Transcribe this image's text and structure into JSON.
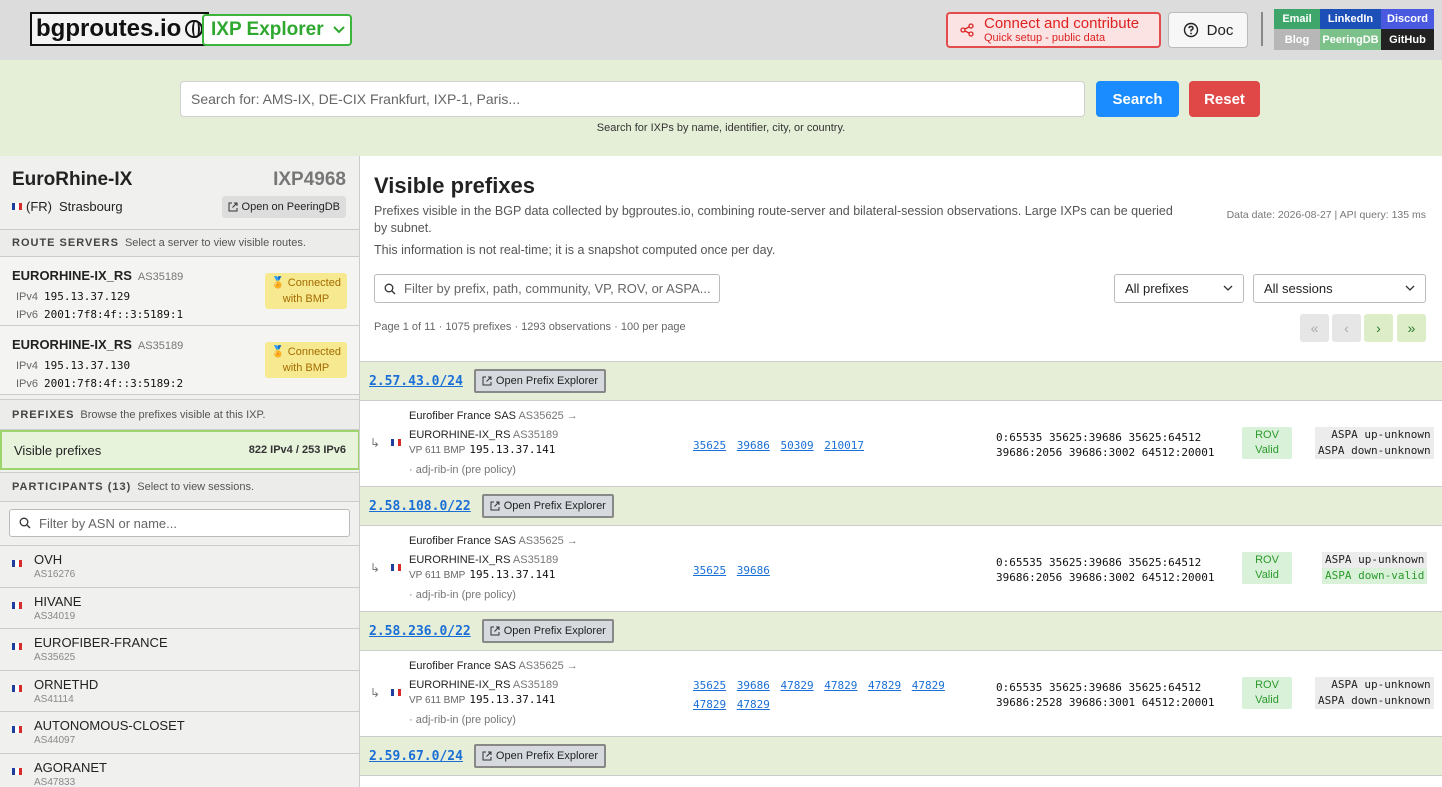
{
  "header": {
    "logo": "bgproutes.io",
    "selector": "IXP Explorer",
    "connect_title": "Connect and contribute",
    "connect_sub": "Quick setup - public data",
    "doc": "Doc",
    "links": {
      "email": "Email",
      "linkedin": "LinkedIn",
      "discord": "Discord",
      "blog": "Blog",
      "peeringdb": "PeeringDB",
      "github": "GitHub"
    }
  },
  "search": {
    "placeholder": "Search for: AMS-IX, DE-CIX Frankfurt, IXP-1, Paris...",
    "search_label": "Search",
    "reset_label": "Reset",
    "hint": "Search for IXPs by name, identifier, city, or country."
  },
  "ixp": {
    "name": "EuroRhine-IX",
    "id": "IXP4968",
    "country": "(FR)",
    "city": "Strasbourg",
    "peeringdb": "Open on PeeringDB"
  },
  "route_servers": {
    "title": "ROUTE SERVERS",
    "hint": "Select a server to view visible routes.",
    "items": [
      {
        "name": "EURORHINE-IX_RS",
        "asn": "AS35189",
        "ipv4_label": "IPv4",
        "ipv4": "195.13.37.129",
        "ipv6_label": "IPv6",
        "ipv6": "2001:7f8:4f::3:5189:1",
        "status_line1": "Connected",
        "status_line2": "with BMP"
      },
      {
        "name": "EURORHINE-IX_RS",
        "asn": "AS35189",
        "ipv4_label": "IPv4",
        "ipv4": "195.13.37.130",
        "ipv6_label": "IPv6",
        "ipv6": "2001:7f8:4f::3:5189:2",
        "status_line1": "Connected",
        "status_line2": "with BMP"
      }
    ]
  },
  "prefixes": {
    "title": "PREFIXES",
    "hint": "Browse the prefixes visible at this IXP.",
    "visible_label": "Visible prefixes",
    "visible_count": "822 IPv4 / 253 IPv6"
  },
  "participants": {
    "title": "PARTICIPANTS (13)",
    "hint": "Select to view sessions.",
    "filter_placeholder": "Filter by ASN or name...",
    "items": [
      {
        "name": "OVH",
        "asn": "AS16276"
      },
      {
        "name": "HIVANE",
        "asn": "AS34019"
      },
      {
        "name": "EUROFIBER-FRANCE",
        "asn": "AS35625"
      },
      {
        "name": "ORNETHD",
        "asn": "AS41114"
      },
      {
        "name": "AUTONOMOUS-CLOSET",
        "asn": "AS44097"
      },
      {
        "name": "AGORANET",
        "asn": "AS47833"
      }
    ]
  },
  "main": {
    "title": "Visible prefixes",
    "desc": "Prefixes visible in the BGP data collected by bgproutes.io, combining route-server and bilateral-session observations. Large IXPs can be queried by subnet.",
    "desc2": "This information is not real-time; it is a snapshot computed once per day.",
    "data_date": "Data date: 2026-08-27 | API query: 135 ms",
    "filter_placeholder": "Filter by prefix, path, community, VP, ROV, or ASPA...",
    "dropdown_prefixes": "All prefixes",
    "dropdown_sessions": "All sessions",
    "page_info": "Page 1 of 11 · 1075 prefixes · 1293 observations · 100 per page",
    "pager": {
      "first": "«",
      "prev": "‹",
      "next": "›",
      "last": "»"
    }
  },
  "prefix_rows": [
    {
      "prefix": "2.57.43.0/24",
      "explorer": "Open Prefix Explorer",
      "org": "Eurofiber France SAS",
      "org_asn": "AS35625 →",
      "rs": "EURORHINE-IX_RS",
      "rs_asn": "AS35189",
      "vp": "VP 611  BMP",
      "vp_ip": "195.13.37.141",
      "adj": "· adj-rib-in (pre policy)",
      "path": [
        "35625",
        "39686",
        "50309",
        "210017"
      ],
      "comm1": "0:65535 35625:39686 35625:64512",
      "comm2": "39686:2056 39686:3002 64512:20001",
      "rov1": "ROV",
      "rov2": "Valid",
      "aspa_up": "ASPA up-unknown",
      "aspa_down": "ASPA down-unknown",
      "aspa_down_valid": false
    },
    {
      "prefix": "2.58.108.0/22",
      "explorer": "Open Prefix Explorer",
      "org": "Eurofiber France SAS",
      "org_asn": "AS35625 →",
      "rs": "EURORHINE-IX_RS",
      "rs_asn": "AS35189",
      "vp": "VP 611  BMP",
      "vp_ip": "195.13.37.141",
      "adj": "· adj-rib-in (pre policy)",
      "path": [
        "35625",
        "39686"
      ],
      "comm1": "0:65535 35625:39686 35625:64512",
      "comm2": "39686:2056 39686:3002 64512:20001",
      "rov1": "ROV",
      "rov2": "Valid",
      "aspa_up": "ASPA up-unknown",
      "aspa_down": "ASPA down-valid",
      "aspa_down_valid": true
    },
    {
      "prefix": "2.58.236.0/22",
      "explorer": "Open Prefix Explorer",
      "org": "Eurofiber France SAS",
      "org_asn": "AS35625 →",
      "rs": "EURORHINE-IX_RS",
      "rs_asn": "AS35189",
      "vp": "VP 611  BMP",
      "vp_ip": "195.13.37.141",
      "adj": "· adj-rib-in (pre policy)",
      "path": [
        "35625",
        "39686",
        "47829",
        "47829",
        "47829",
        "47829",
        "47829",
        "47829"
      ],
      "comm1": "0:65535 35625:39686 35625:64512",
      "comm2": "39686:2528 39686:3001 64512:20001",
      "rov1": "ROV",
      "rov2": "Valid",
      "aspa_up": "ASPA up-unknown",
      "aspa_down": "ASPA down-unknown",
      "aspa_down_valid": false
    }
  ],
  "last_prefix": {
    "prefix": "2.59.67.0/24",
    "explorer": "Open Prefix Explorer"
  },
  "colors": {
    "accent_green": "#3db53d",
    "search_blue": "#1a8cff",
    "reset_red": "#e04848",
    "link_blue": "#1a6fd6"
  }
}
